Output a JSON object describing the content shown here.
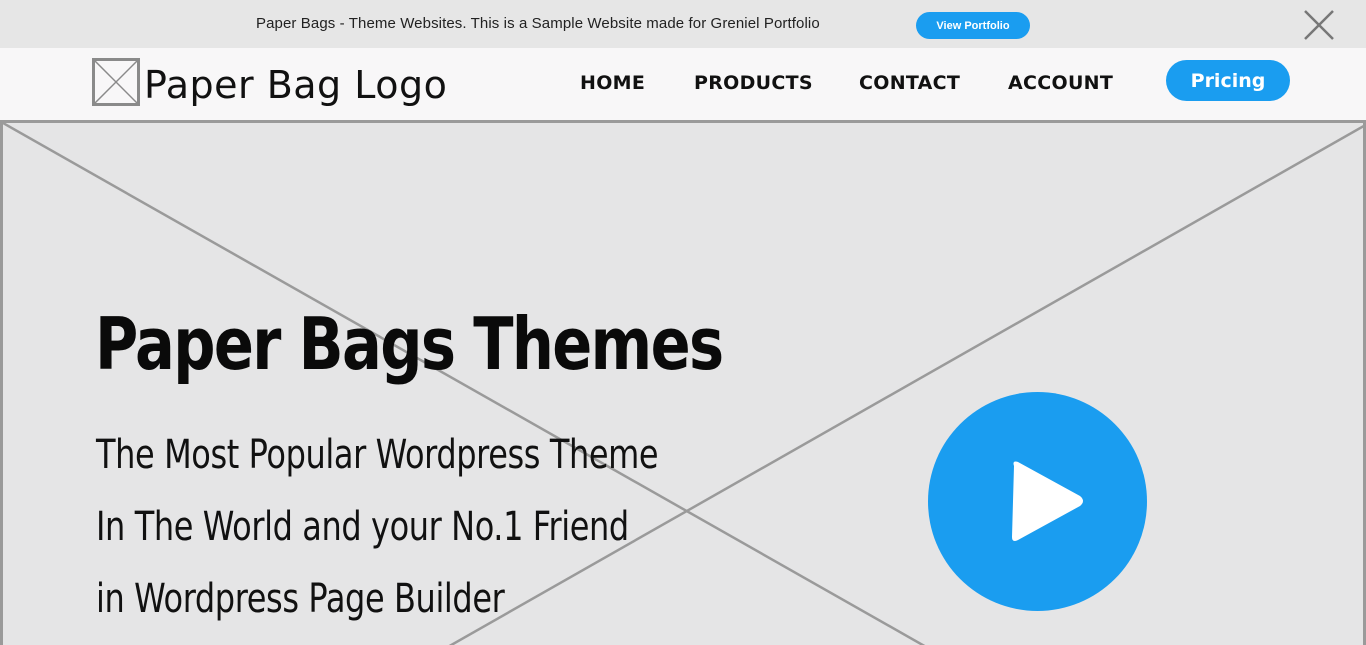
{
  "announcement": {
    "text": "Paper Bags - Theme Websites. This is a Sample Website made for Greniel Portfolio",
    "button_label": "View Portfolio",
    "close_icon": "close-icon"
  },
  "navbar": {
    "logo_text": "Paper Bag Logo",
    "logo_icon": "image-placeholder-icon",
    "links": [
      "HOME",
      "PRODUCTS",
      "CONTACT",
      "ACCOUNT"
    ],
    "pricing_label": "Pricing"
  },
  "hero": {
    "title": "Paper Bags Themes",
    "subtitle_lines": [
      "The Most Popular Wordpress Theme",
      "In The World and your No.1 Friend",
      "in Wordpress Page Builder"
    ],
    "play_icon": "play-icon",
    "background_icon": "image-placeholder-icon"
  },
  "colors": {
    "accent": "#1a9df0",
    "announcement_bg": "#e6e6e6",
    "navbar_bg": "#f8f7f8",
    "hero_bg": "#e5e5e6",
    "placeholder_stroke": "#9a9a9a",
    "text": "#111111"
  }
}
